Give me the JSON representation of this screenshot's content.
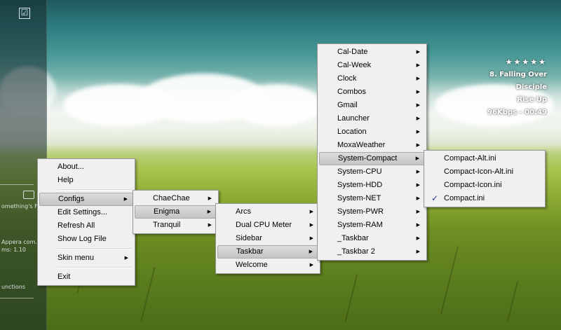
{
  "left_panel": {
    "check_glyph": "☑",
    "texts": [
      "omething's Fi...",
      "Appera com...",
      "ms: 1.10",
      "unctions"
    ]
  },
  "now_playing": {
    "stars": "★★★★★",
    "track": "8. Falling Over",
    "artist": "Disciple",
    "album": "Rise Up",
    "status": "96Kbps - 00:49"
  },
  "menus": {
    "main": {
      "items": [
        {
          "label": "About...",
          "submenu": false
        },
        {
          "label": "Help",
          "submenu": false
        },
        {
          "separator": true
        },
        {
          "label": "Configs",
          "submenu": true,
          "highlighted": true
        },
        {
          "label": "Edit Settings...",
          "submenu": false
        },
        {
          "label": "Refresh All",
          "submenu": false
        },
        {
          "label": "Show Log File",
          "submenu": false
        },
        {
          "separator": true
        },
        {
          "label": "Skin menu",
          "submenu": true
        },
        {
          "separator": true
        },
        {
          "label": "Exit",
          "submenu": false
        }
      ]
    },
    "configs": {
      "items": [
        {
          "label": "ChaeChae",
          "submenu": true
        },
        {
          "label": "Enigma",
          "submenu": true,
          "highlighted": true
        },
        {
          "label": "Tranquil",
          "submenu": true
        }
      ]
    },
    "enigma": {
      "items": [
        {
          "label": "Arcs",
          "submenu": true
        },
        {
          "label": "Dual CPU Meter",
          "submenu": true
        },
        {
          "label": "Sidebar",
          "submenu": true
        },
        {
          "label": "Taskbar",
          "submenu": true,
          "highlighted": true
        },
        {
          "label": "Welcome",
          "submenu": true
        }
      ]
    },
    "taskbar": {
      "items": [
        {
          "label": "Cal-Date",
          "submenu": true
        },
        {
          "label": "Cal-Week",
          "submenu": true
        },
        {
          "label": "Clock",
          "submenu": true
        },
        {
          "label": "Combos",
          "submenu": true
        },
        {
          "label": "Gmail",
          "submenu": true
        },
        {
          "label": "Launcher",
          "submenu": true
        },
        {
          "label": "Location",
          "submenu": true
        },
        {
          "label": "MoxaWeather",
          "submenu": true
        },
        {
          "label": "System-Compact",
          "submenu": true,
          "highlighted": true
        },
        {
          "label": "System-CPU",
          "submenu": true
        },
        {
          "label": "System-HDD",
          "submenu": true
        },
        {
          "label": "System-NET",
          "submenu": true
        },
        {
          "label": "System-PWR",
          "submenu": true
        },
        {
          "label": "System-RAM",
          "submenu": true
        },
        {
          "label": "_Taskbar",
          "submenu": true
        },
        {
          "label": "_Taskbar 2",
          "submenu": true
        }
      ]
    },
    "system_compact": {
      "items": [
        {
          "label": "Compact-Alt.ini"
        },
        {
          "label": "Compact-Icon-Alt.ini"
        },
        {
          "label": "Compact-Icon.ini"
        },
        {
          "label": "Compact.ini",
          "checked": true
        }
      ]
    }
  },
  "glyphs": {
    "arrow": "▶",
    "check": "✓"
  }
}
